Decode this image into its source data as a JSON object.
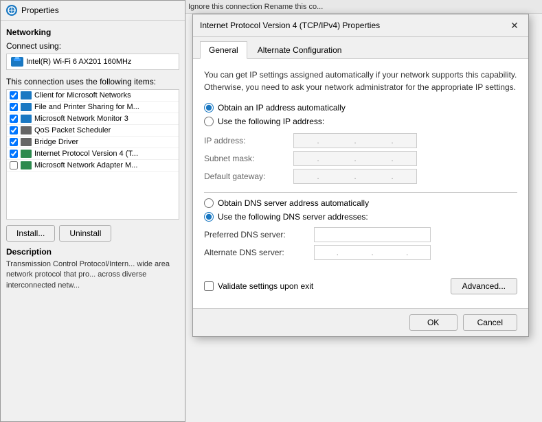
{
  "bg_window": {
    "title": "Properties",
    "icon_label": "N",
    "networking_label": "Networking",
    "connect_using_label": "Connect using:",
    "adapter_name": "Intel(R) Wi-Fi 6 AX201 160MHz",
    "connection_uses_label": "This connection uses the following items:",
    "list_items": [
      {
        "checked": true,
        "label": "Client for Microsoft Networks"
      },
      {
        "checked": true,
        "label": "File and Printer Sharing for M..."
      },
      {
        "checked": true,
        "label": "Microsoft Network Monitor 3"
      },
      {
        "checked": true,
        "label": "QoS Packet Scheduler"
      },
      {
        "checked": true,
        "label": "Bridge Driver"
      },
      {
        "checked": true,
        "label": "Internet Protocol Version 4 (T..."
      },
      {
        "checked": false,
        "label": "Microsoft Network Adapter M..."
      }
    ],
    "install_btn": "Install...",
    "uninstall_btn": "Uninstall",
    "description_label": "Description",
    "description_text": "Transmission Control Protocol/Intern... wide area network protocol that pro... across diverse interconnected netw..."
  },
  "top_bar": {
    "text": "Ignore this connection    Rename this co..."
  },
  "dialog": {
    "title": "Internet Protocol Version 4 (TCP/IPv4) Properties",
    "close_btn": "✕",
    "tabs": [
      {
        "label": "General",
        "active": true
      },
      {
        "label": "Alternate Configuration",
        "active": false
      }
    ],
    "info_text": "You can get IP settings assigned automatically if your network supports this capability. Otherwise, you need to ask your network administrator for the appropriate IP settings.",
    "ip_section": {
      "obtain_auto_label": "Obtain an IP address automatically",
      "obtain_auto_checked": true,
      "use_following_label": "Use the following IP address:",
      "use_following_checked": false,
      "ip_address_label": "IP address:",
      "ip_address_placeholder": ". . .",
      "subnet_mask_label": "Subnet mask:",
      "subnet_mask_placeholder": ". . .",
      "default_gateway_label": "Default gateway:",
      "default_gateway_placeholder": ". . ."
    },
    "dns_section": {
      "obtain_auto_label": "Obtain DNS server address automatically",
      "obtain_auto_checked": false,
      "use_following_label": "Use the following DNS server addresses:",
      "use_following_checked": true,
      "preferred_label": "Preferred DNS server:",
      "preferred_value": "",
      "alternate_label": "Alternate DNS server:",
      "alternate_placeholder": ". . ."
    },
    "validate_label": "Validate settings upon exit",
    "validate_checked": false,
    "advanced_btn": "Advanced...",
    "ok_btn": "OK",
    "cancel_btn": "Cancel"
  }
}
